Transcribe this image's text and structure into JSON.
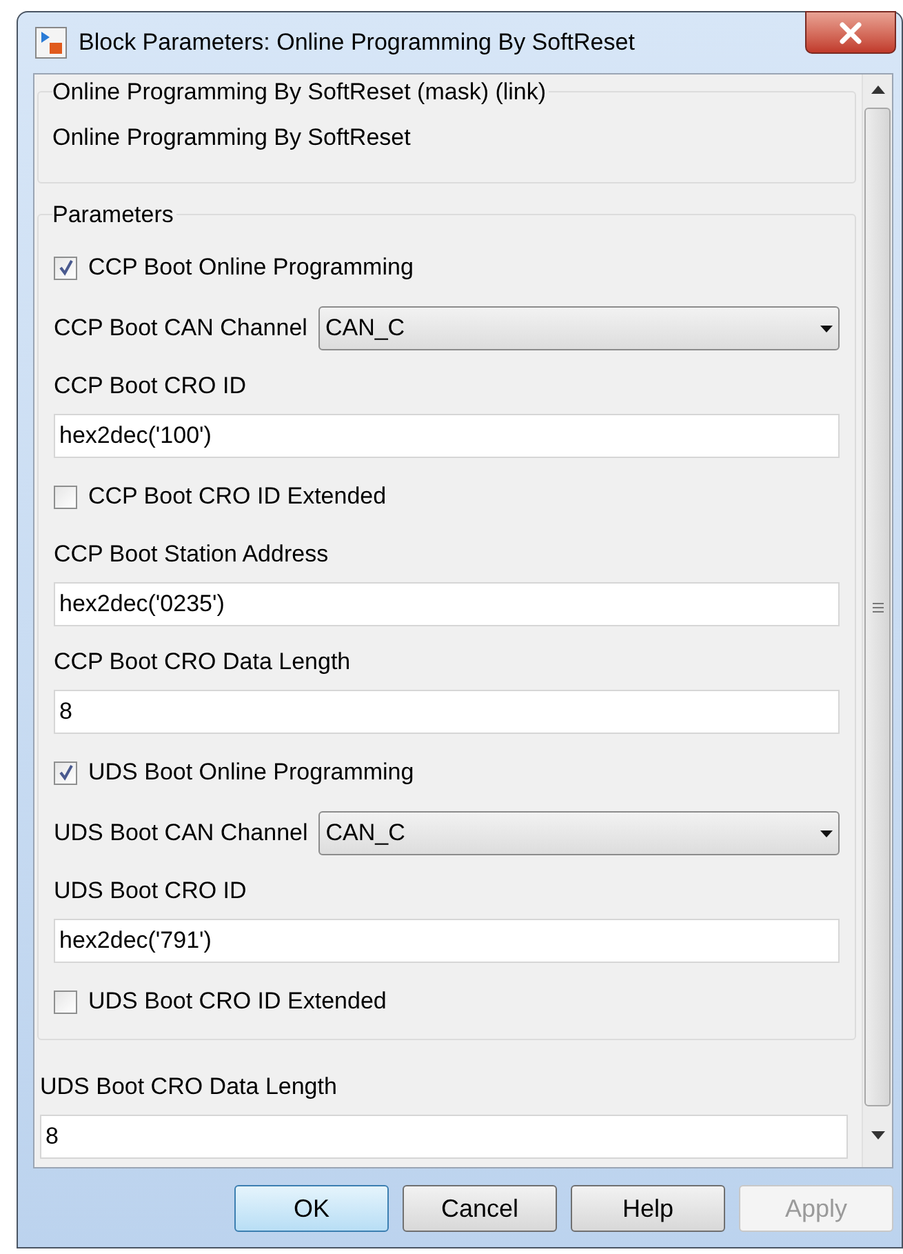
{
  "window": {
    "title": "Block Parameters: Online Programming By SoftReset"
  },
  "description": {
    "title": "Online Programming By SoftReset (mask) (link)",
    "text": "Online Programming By SoftReset"
  },
  "parameters": {
    "title": "Parameters",
    "items": [
      {
        "kind": "checkbox",
        "label": "CCP Boot Online Programming",
        "checked": true
      },
      {
        "kind": "popup",
        "label": "CCP Boot CAN Channel",
        "value": "CAN_C"
      },
      {
        "kind": "edit",
        "label": "CCP Boot CRO ID",
        "value": "hex2dec('100')"
      },
      {
        "kind": "checkbox",
        "label": "CCP Boot CRO ID Extended",
        "checked": false
      },
      {
        "kind": "edit",
        "label": "CCP Boot Station Address",
        "value": "hex2dec('0235')"
      },
      {
        "kind": "edit",
        "label": "CCP Boot CRO Data Length",
        "value": "8"
      },
      {
        "kind": "checkbox",
        "label": "UDS Boot Online Programming",
        "checked": true
      },
      {
        "kind": "popup",
        "label": "UDS Boot CAN Channel",
        "value": "CAN_C"
      },
      {
        "kind": "edit",
        "label": "UDS Boot CRO ID",
        "value": "hex2dec('791')"
      },
      {
        "kind": "checkbox",
        "label": "UDS Boot CRO ID Extended",
        "checked": false
      }
    ]
  },
  "ungrouped_parameters": [
    {
      "kind": "edit",
      "label": "UDS Boot CRO Data Length",
      "value": "8"
    }
  ],
  "buttons": [
    {
      "label": "OK",
      "default": true,
      "disabled": false
    },
    {
      "label": "Cancel",
      "default": false,
      "disabled": false
    },
    {
      "label": "Help",
      "default": false,
      "disabled": false
    },
    {
      "label": "Apply",
      "default": false,
      "disabled": true
    }
  ]
}
